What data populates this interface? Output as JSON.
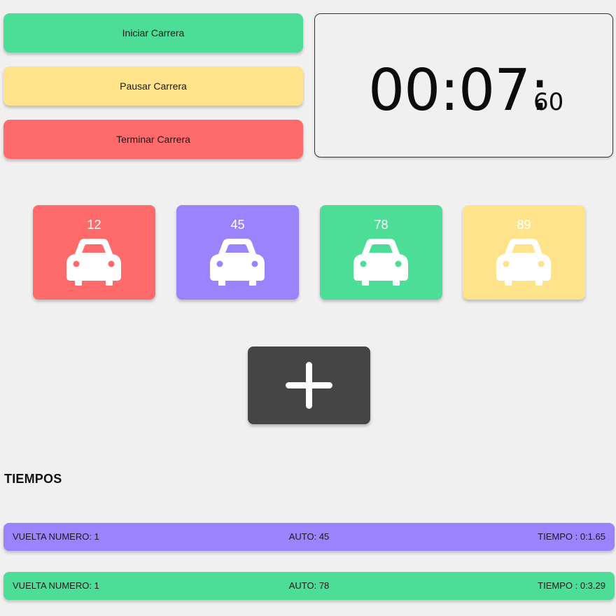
{
  "controls": {
    "start_label": "Iniciar Carrera",
    "pause_label": "Pausar Carrera",
    "end_label": "Terminar Carrera"
  },
  "timer": {
    "main": "00:07:",
    "ms": "60"
  },
  "cars": [
    {
      "number": "12",
      "color": "#ff6b6b",
      "icon": "car-icon"
    },
    {
      "number": "45",
      "color": "#9b82ff",
      "icon": "car-icon"
    },
    {
      "number": "78",
      "color": "#4cdd96",
      "icon": "car-icon"
    },
    {
      "number": "89",
      "color": "#ffe38a",
      "icon": "car-icon"
    }
  ],
  "add_button": {
    "icon": "plus-icon",
    "color": "#454545"
  },
  "times": {
    "title": "TIEMPOS",
    "laps": [
      {
        "lap": "VUELTA NUMERO: 1",
        "car": "AUTO: 45",
        "time": "TIEMPO : 0:1.65",
        "color": "#9b82ff"
      },
      {
        "lap": "VUELTA NUMERO: 1",
        "car": "AUTO: 78",
        "time": "TIEMPO : 0:3.29",
        "color": "#4cdd96"
      }
    ]
  }
}
